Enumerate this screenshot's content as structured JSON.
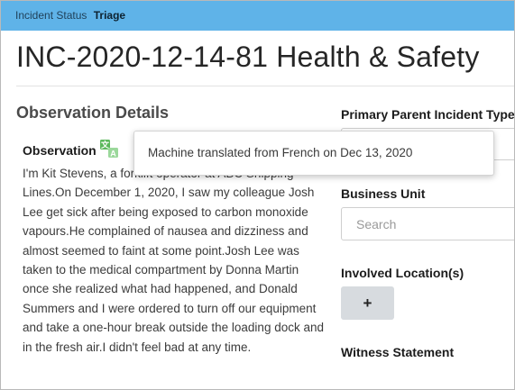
{
  "status_bar": {
    "label": "Incident Status",
    "value": "Triage"
  },
  "page_title": "INC-2020-12-14-81 Health & Safety",
  "observation_details": {
    "heading": "Observation Details",
    "observation_label": "Observation",
    "translate_icon": "translate-icon",
    "observation_text": "I'm Kit Stevens, a forklift operator at ABC Shipping Lines.On December 1, 2020, I saw my colleague Josh Lee get sick after being exposed to carbon monoxide vapours.He complained of nausea and dizziness and almost seemed to faint at some point.Josh Lee was taken to the medical compartment by Donna Martin once she realized what had happened, and Donald Summers and I were ordered to turn off our equipment and take a one-hour break outside the loading dock and in the fresh air.I didn't feel bad at any time."
  },
  "fields": {
    "primary_parent_label": "Primary Parent Incident Type",
    "business_unit_label": "Business Unit",
    "business_unit_placeholder": "Search",
    "involved_locations_label": "Involved Location(s)",
    "add_location_button": "+",
    "witness_statement_label": "Witness Statement"
  },
  "tooltip": {
    "text": "Machine translated from French on Dec 13, 2020"
  },
  "colors": {
    "status_bar": "#5fb3e8",
    "translate_icon": "#5cb85c",
    "button_bg": "#d7dbdf"
  }
}
